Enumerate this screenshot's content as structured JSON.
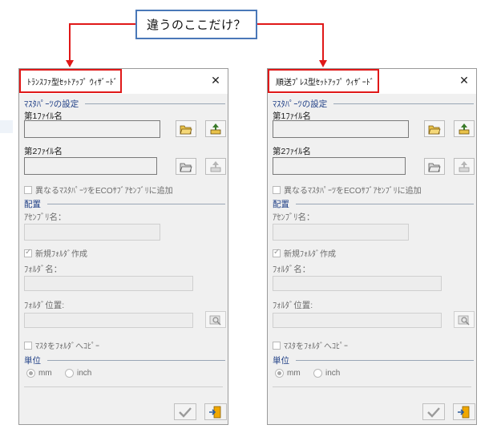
{
  "callout": {
    "text": "違うのここだけ？"
  },
  "dialogs": [
    {
      "title": "ﾄﾗﾝｽﾌｧ型ｾｯﾄｱｯﾌﾟ ｳｨｻﾞｰﾄﾞ",
      "master_section": "ﾏｽﾀﾊﾟｰﾂの設定",
      "file1_label": "第1ﾌｧｲﾙ名",
      "file2_label": "第2ﾌｧｲﾙ名",
      "add_eco_checkbox": "異なるﾏｽﾀﾊﾟｰﾂをECOｻﾌﾞｱｾﾝﾌﾞﾘに追加",
      "layout_section": "配置",
      "assembly_label": "ｱｾﾝﾌﾞﾘ名：",
      "new_folder_checkbox": "新規ﾌｫﾙﾀﾞ作成",
      "folder_name_label": "ﾌｫﾙﾀﾞ名：",
      "folder_location_label": "ﾌｫﾙﾀﾞ位置:",
      "copy_master_checkbox": "ﾏｽﾀをﾌｫﾙﾀﾞへｺﾋﾟｰ",
      "unit_section": "単位",
      "unit_mm": "mm",
      "unit_inch": "inch"
    },
    {
      "title": "順送ﾌﾟﾚｽ型ｾｯﾄｱｯﾌﾟ ｳｨｻﾞｰﾄﾞ",
      "master_section": "ﾏｽﾀﾊﾟｰﾂの設定",
      "file1_label": "第1ﾌｧｲﾙ名",
      "file2_label": "第2ﾌｧｲﾙ名",
      "add_eco_checkbox": "異なるﾏｽﾀﾊﾟｰﾂをECOｻﾌﾞｱｾﾝﾌﾞﾘに追加",
      "layout_section": "配置",
      "assembly_label": "ｱｾﾝﾌﾞﾘ名：",
      "new_folder_checkbox": "新規ﾌｫﾙﾀﾞ作成",
      "folder_name_label": "ﾌｫﾙﾀﾞ名：",
      "folder_location_label": "ﾌｫﾙﾀﾞ位置:",
      "copy_master_checkbox": "ﾏｽﾀをﾌｫﾙﾀﾞへｺﾋﾟｰ",
      "unit_section": "単位",
      "unit_mm": "mm",
      "unit_inch": "inch"
    }
  ],
  "state": {
    "new_folder_checked": true,
    "add_eco_checked": false,
    "copy_master_checked": false,
    "unit_selected": "mm"
  },
  "colors": {
    "highlight_red": "#e01818",
    "callout_border": "#4a78b8",
    "section_text": "#1f3f86",
    "folder_icon": "#e8c24a",
    "confirm_icon": "#f0a800"
  },
  "icons": [
    "folder-open-icon",
    "upload-icon",
    "view-icon",
    "checkmark-icon",
    "exit-icon",
    "close-icon"
  ]
}
